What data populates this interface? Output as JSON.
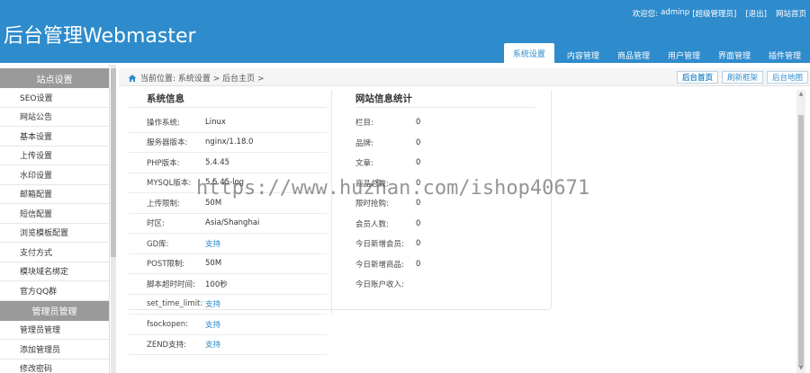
{
  "app": {
    "logo": "后台管理Webmaster"
  },
  "topbar": {
    "welcome": "欢迎您:",
    "user": "adminp",
    "role": "[超级管理员]",
    "logout": "[退出]",
    "home": "网站首页"
  },
  "tabs": [
    {
      "label": "系统设置",
      "active": true
    },
    {
      "label": "内容管理"
    },
    {
      "label": "商品管理"
    },
    {
      "label": "用户管理"
    },
    {
      "label": "界面管理"
    },
    {
      "label": "插件管理"
    }
  ],
  "sidebar": {
    "group1": "站点设置",
    "items1": [
      "SEO设置",
      "网站公告",
      "基本设置",
      "上传设置",
      "水印设置",
      "邮箱配置",
      "短信配置",
      "浏览模板配置",
      "支付方式",
      "模块域名绑定",
      "官方QQ群"
    ],
    "group2": "管理员管理",
    "items2": [
      "管理员管理",
      "添加管理员",
      "修改密码"
    ]
  },
  "breadcrumb": {
    "text": "当前位置: 系统设置 > 后台主页 >",
    "buttons": [
      "后台首页",
      "刷新框架",
      "后台地图"
    ]
  },
  "sysinfo": {
    "title": "系统信息",
    "rows": [
      {
        "k": "操作系统:",
        "v": "Linux"
      },
      {
        "k": "服务器版本:",
        "v": "nginx/1.18.0"
      },
      {
        "k": "PHP版本:",
        "v": "5.4.45"
      },
      {
        "k": "MYSQL版本:",
        "v": "5.5.45-log"
      },
      {
        "k": "上传限制:",
        "v": "50M"
      },
      {
        "k": "时区:",
        "v": "Asia/Shanghai"
      },
      {
        "k": "GD库:",
        "v": "支持",
        "link": true
      },
      {
        "k": "POST限制:",
        "v": "50M"
      },
      {
        "k": "脚本超时时间:",
        "v": "100秒"
      },
      {
        "k": "set_time_limit:",
        "v": "支持",
        "link": true
      },
      {
        "k": "fsockopen:",
        "v": "支持",
        "link": true
      },
      {
        "k": "ZEND支持:",
        "v": "支持",
        "link": true
      }
    ]
  },
  "stats": {
    "title": "网站信息统计",
    "rows": [
      {
        "k": "栏目:",
        "v": "0"
      },
      {
        "k": "品牌:",
        "v": "0"
      },
      {
        "k": "文章:",
        "v": "0"
      },
      {
        "k": "商品总数:",
        "v": "0"
      },
      {
        "k": "限时抢购:",
        "v": "0"
      },
      {
        "k": "会员人数:",
        "v": "0"
      },
      {
        "k": "今日新增会员:",
        "v": "0"
      },
      {
        "k": "今日新增商品:",
        "v": "0"
      },
      {
        "k": "今日账户收入:",
        "v": ""
      }
    ]
  },
  "watermark": "https://www.huzhan.com/ishop40671"
}
